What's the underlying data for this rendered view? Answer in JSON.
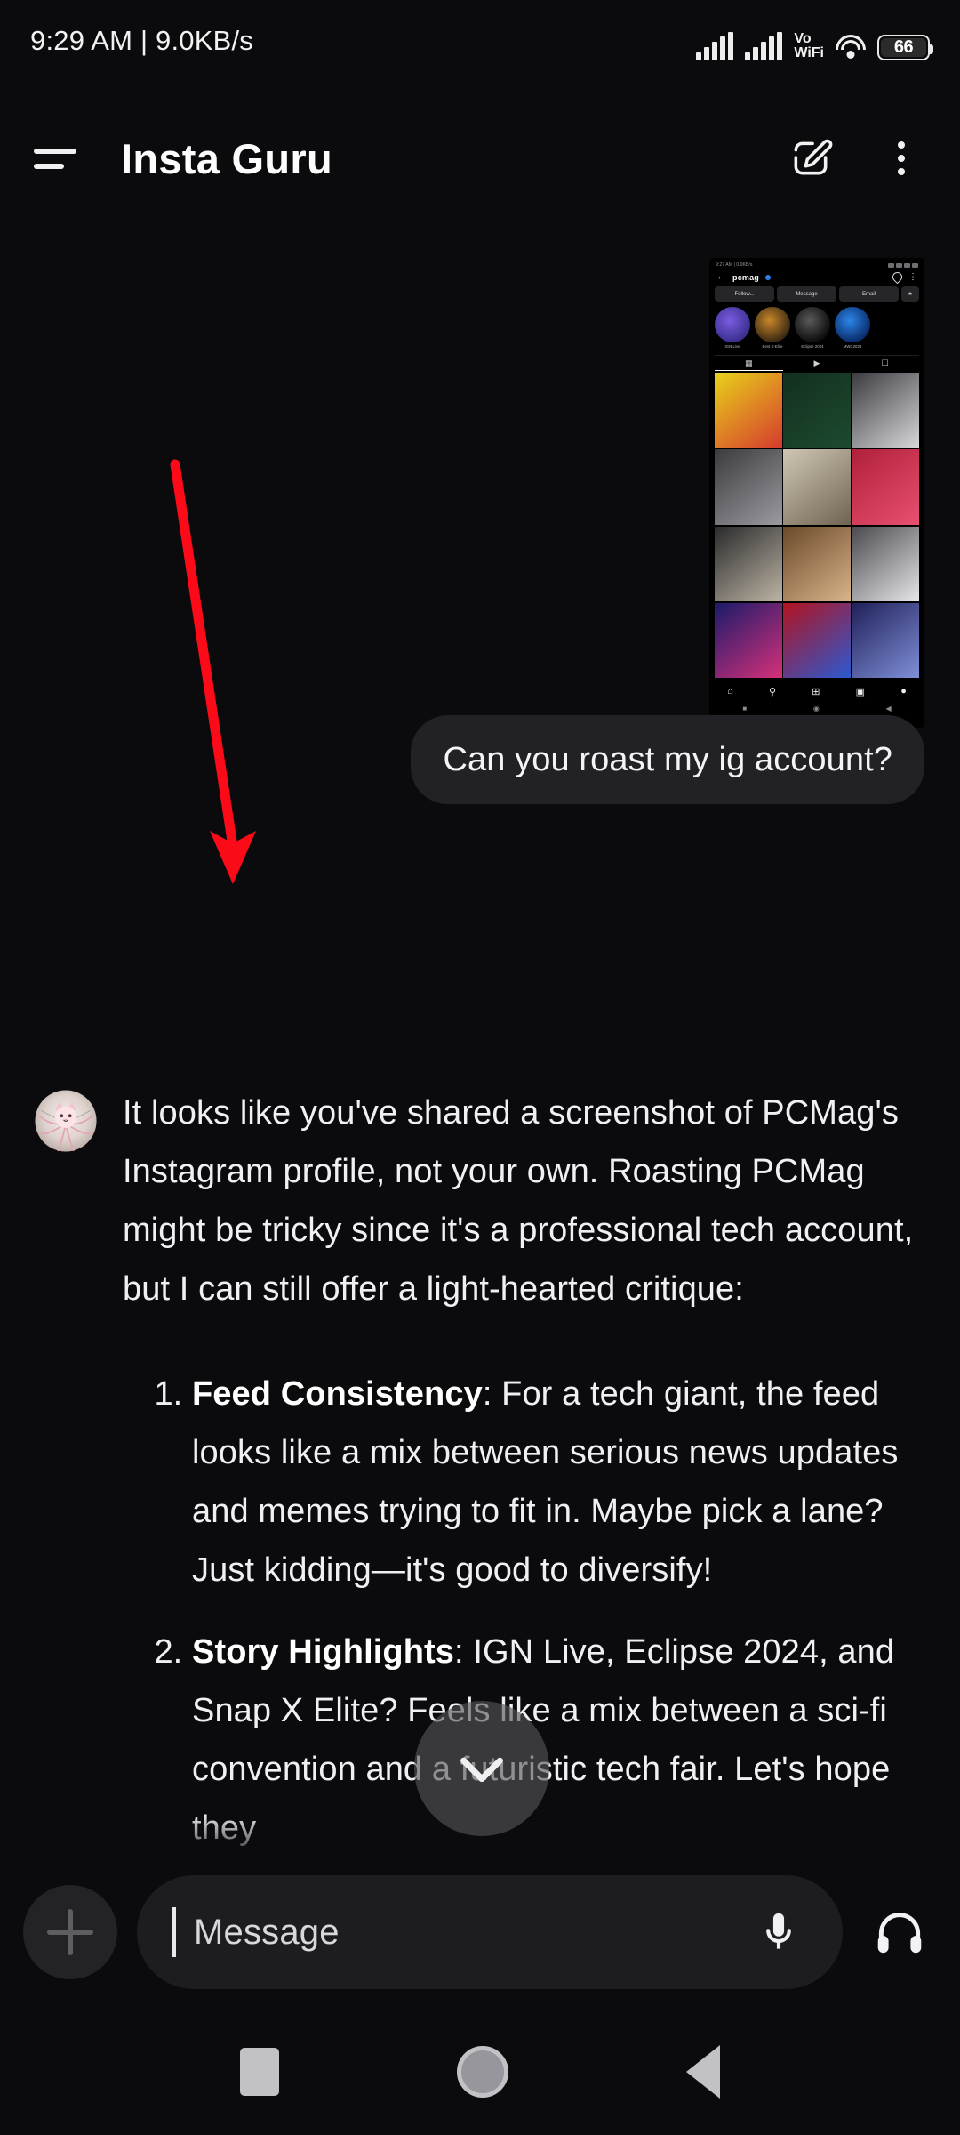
{
  "statusbar": {
    "time_and_speed": "9:29 AM | 9.0KB/s",
    "volte_label": "Vo",
    "wifi_label": "WiFi",
    "battery_percent": "66",
    "signal_icon": "signal-bars-icon",
    "signal_icon_2": "signal-bars-icon-sim2",
    "wifi_icon": "wifi-icon",
    "battery_icon": "battery-icon"
  },
  "appbar": {
    "menu_icon": "hamburger-menu-icon",
    "title": "Insta Guru",
    "compose_icon": "compose-edit-icon",
    "overflow_icon": "overflow-menu-icon"
  },
  "attachment": {
    "type": "instagram-profile-screenshot",
    "status_time": "9:27 AM | 0.0KB/s",
    "back_icon": "back-arrow-icon",
    "username": "pcmag",
    "verified_badge": "verified-badge-icon",
    "notify_icon": "notification-bell-icon",
    "kebab_icon": "overflow-menu-icon",
    "buttons": [
      "Follow...",
      "Message",
      "Email"
    ],
    "extra_button_icon": "add-person-icon",
    "highlights": [
      {
        "label": "IGN Live",
        "color1": "#3a2f8f",
        "color2": "#7b5ce0"
      },
      {
        "label": "Best X-Elite",
        "color1": "#3a2a12",
        "color2": "#c9862a"
      },
      {
        "label": "Eclipse 2024",
        "color1": "#0d0d0d",
        "color2": "#5a5a5a"
      },
      {
        "label": "MWC2024",
        "color1": "#0a2c6b",
        "color2": "#2b86e8"
      }
    ],
    "tabs": [
      "grid-icon",
      "reels-icon",
      "tagged-icon"
    ],
    "active_tab": 0,
    "grid_cells": [
      {
        "c1": "#e8d21a",
        "c2": "#d53a2e"
      },
      {
        "c1": "#12301e",
        "c2": "#1d4a30"
      },
      {
        "c1": "#3a3a3f",
        "c2": "#d8d8dc"
      },
      {
        "c1": "#3b3b3f",
        "c2": "#9a9aa0"
      },
      {
        "c1": "#cfc7b4",
        "c2": "#6f6451"
      },
      {
        "c1": "#b0203a",
        "c2": "#e85070"
      },
      {
        "c1": "#2a2a2c",
        "c2": "#bdb4a4"
      },
      {
        "c1": "#6b4a2a",
        "c2": "#d8b48a"
      },
      {
        "c1": "#4a4a4e",
        "c2": "#e6e6ea"
      },
      {
        "c1": "#1b1b6a",
        "c2": "#d6307a"
      },
      {
        "c1": "#b31220",
        "c2": "#2a5ad0"
      },
      {
        "c1": "#202058",
        "c2": "#7f8fd8"
      }
    ],
    "nav_icons": [
      "home-icon",
      "search-icon",
      "add-post-icon",
      "reels-icon",
      "profile-icon"
    ],
    "sys_nav_icons": [
      "recents-icon",
      "home-icon",
      "back-icon"
    ]
  },
  "annotation": {
    "arrow_color": "#fb0a18",
    "arrow_name": "red-pointer-arrow"
  },
  "conversation": {
    "user_message": "Can you roast my ig account?",
    "assistant_avatar": "assistant-avatar-cat",
    "assistant_intro": "It looks like you've shared a screenshot of PCMag's Instagram profile, not your own. Roasting PCMag might be tricky since it's a professional tech account, but I can still offer a light-hearted critique:",
    "assistant_points": [
      {
        "title": "Feed Consistency",
        "body": ": For a tech giant, the feed looks like a mix between serious news updates and memes trying to fit in. Maybe pick a lane? Just kidding—it's good to diversify!"
      },
      {
        "title": "Story Highlights",
        "body": ": IGN Live, Eclipse 2024, and Snap X Elite? Feels like a mix between a sci-fi convention and a futuristic tech fair. Let's hope they"
      }
    ]
  },
  "scroll_fab": {
    "icon": "chevron-down-icon"
  },
  "composer": {
    "plus_icon": "add-attachment-icon",
    "placeholder": "Message",
    "value": "",
    "mic_icon": "microphone-icon",
    "headphones_icon": "headphones-voice-mode-icon"
  },
  "system_nav": {
    "recents_icon": "recents-square-icon",
    "home_icon": "home-circle-icon",
    "back_icon": "back-triangle-icon"
  },
  "colors": {
    "background": "#0b0b0d",
    "bubble": "#222226",
    "input": "#1d1d20",
    "text": "#f0f0f2",
    "accent_red": "#fb0a18"
  }
}
